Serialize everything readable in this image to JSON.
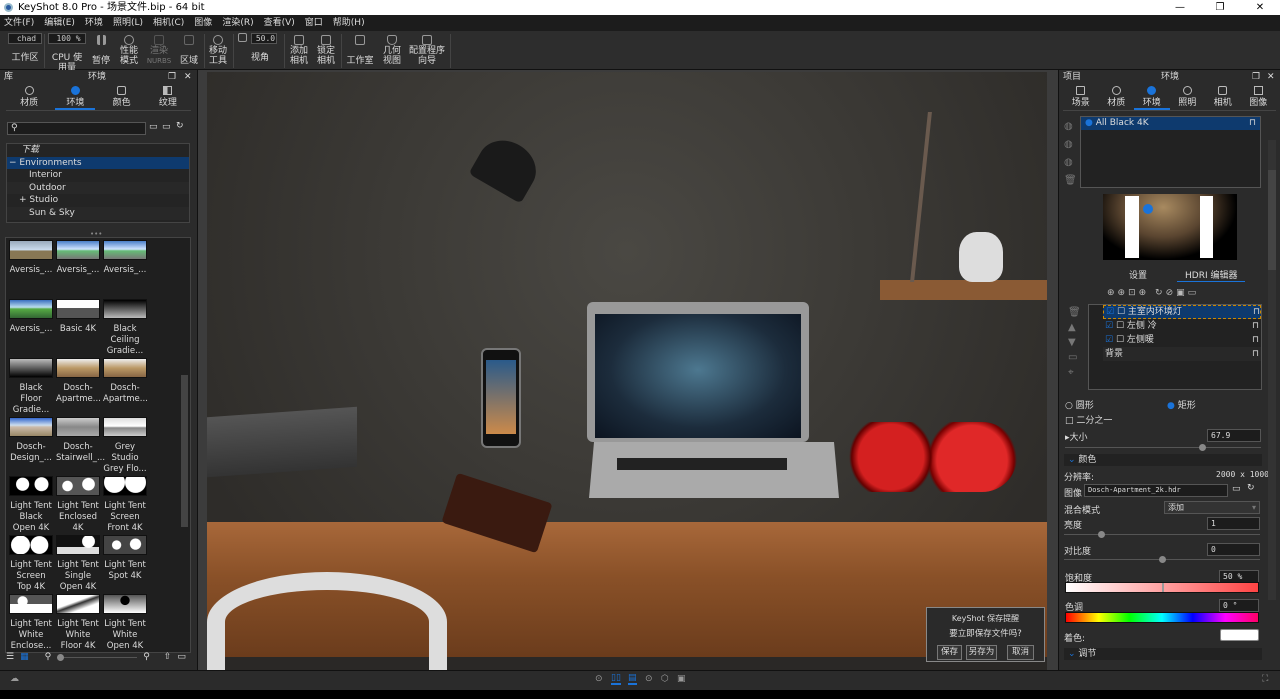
{
  "window": {
    "title": "KeyShot 8.0 Pro  - 场景文件.bip  - 64 bit",
    "min": "—",
    "max": "❐",
    "close": "✕"
  },
  "menu": [
    "文件(F)",
    "编辑(E)",
    "环境",
    "照明(L)",
    "相机(C)",
    "图像",
    "渲染(R)",
    "查看(V)",
    "窗口",
    "帮助(H)"
  ],
  "toolbar": {
    "workspace_value": "chad",
    "workspace": "工作区",
    "cpu_value": "100 %",
    "cpu": "CPU 使用量",
    "pause": "暂停",
    "perf1": "性能",
    "perf2": "模式",
    "nurbs1": "渲染",
    "nurbs2": "NURBS",
    "region": "区域",
    "move1": "移动",
    "move2": "工具",
    "fov_value": "50.0",
    "fov": "视角",
    "addcam1": "添加",
    "addcam2": "相机",
    "lockcam1": "锁定",
    "lockcam2": "相机",
    "studio": "工作室",
    "geo1": "几何",
    "geo2": "视图",
    "wizard1": "配置程序",
    "wizard2": "向导"
  },
  "library": {
    "header": "库",
    "title": "环境",
    "tabs": [
      {
        "label": "材质"
      },
      {
        "label": "环境"
      },
      {
        "label": "颜色"
      },
      {
        "label": "纹理"
      }
    ],
    "search_placeholder": "",
    "tree": [
      "下载",
      "Environments",
      "Interior",
      "Outdoor",
      "Studio",
      "Sun & Sky"
    ],
    "thumbs": [
      {
        "label": "Aversis_...",
        "bg": "linear-gradient(#9ab,#cde 50%,#875 55%)"
      },
      {
        "label": "Aversis_...",
        "bg": "linear-gradient(#4a7fc8,#cfe3ff 45%,#6b7 55%,#777)"
      },
      {
        "label": "Aversis_...",
        "bg": "linear-gradient(#4a7fc8,#cfe3ff 45%,#6b7 55%,#777)"
      },
      {
        "label": "Aversis_...",
        "bg": "linear-gradient(#3a6fc0,#bde 40%,#5a4 50%,#363)"
      },
      {
        "label": "Basic 4K",
        "bg": "linear-gradient(#fff 45%,#555 45%)"
      },
      {
        "label": "Black Ceiling Gradie...",
        "bg": "linear-gradient(#000,#bbb)"
      },
      {
        "label": "Black Floor Gradie...",
        "bg": "linear-gradient(#bbb,#000)"
      },
      {
        "label": "Dosch-Apartme...",
        "bg": "linear-gradient(#eee,#b96 50%,#864)"
      },
      {
        "label": "Dosch-Apartme...",
        "bg": "linear-gradient(#eee,#b96 50%,#864)"
      },
      {
        "label": "Dosch-Design_...",
        "bg": "linear-gradient(#36c,#cde 40%,#cba 50%,#986)"
      },
      {
        "label": "Dosch-Stairwell_...",
        "bg": "linear-gradient(#ccc,#888 50%,#aaa)"
      },
      {
        "label": "Grey Studio Grey Flo...",
        "bg": "linear-gradient(#ddd,#fff 45%,#888 55%,#ccc)"
      },
      {
        "label": "Light Tent Black Open 4K",
        "bg": "radial-gradient(circle at 30% 40%,#fff 20%,transparent 22%),radial-gradient(circle at 75% 40%,#fff 20%,#000 22%)"
      },
      {
        "label": "Light Tent Enclosed 4K",
        "bg": "radial-gradient(circle at 25% 50%,#fff 15%,transparent 17%),radial-gradient(circle at 75% 40%,#fff 18%,#555 20%)"
      },
      {
        "label": "Light Tent Screen Front 4K",
        "bg": "radial-gradient(circle at 25% 30%,#fff 30%,transparent 32%),radial-gradient(circle at 75% 30%,#fff 30%,#000 32%)"
      },
      {
        "label": "Light Tent Screen Top 4K",
        "bg": "radial-gradient(circle at 25% 50%,#fff 28%,transparent 30%),radial-gradient(circle at 70% 50%,#fff 28%,#000 30%)"
      },
      {
        "label": "Light Tent Single Open 4K",
        "bg": "radial-gradient(circle at 75% 30%,#fff 18%,transparent 20%),linear-gradient(#111 60%,#ddd 60%)"
      },
      {
        "label": "Light Tent Spot 4K",
        "bg": "radial-gradient(circle at 30% 50%,#fff 14%,transparent 16%),radial-gradient(circle at 75% 45%,#fff 16%,#444 18%)"
      },
      {
        "label": "Light Tent White Enclose...",
        "bg": "radial-gradient(circle at 30% 35%,#fff 15%,transparent 17%),linear-gradient(#555 50%,#fff 50%)"
      },
      {
        "label": "Light Tent White Floor 4K",
        "bg": "linear-gradient(160deg,#fff 40%,#333 50%,#fff 70%)"
      },
      {
        "label": "Light Tent White Open 4K",
        "bg": "radial-gradient(circle at 50% 30%,#000 18%,transparent 20%),linear-gradient(#555,#fff)"
      }
    ]
  },
  "project": {
    "header": "项目",
    "title": "环境",
    "tabs": [
      {
        "label": "场景"
      },
      {
        "label": "材质"
      },
      {
        "label": "环境"
      },
      {
        "label": "照明"
      },
      {
        "label": "相机"
      },
      {
        "label": "图像"
      }
    ],
    "env_list": [
      "All Black 4K"
    ],
    "subtabs": [
      "设置",
      "HDRI 编辑器"
    ],
    "pins": [
      {
        "name": "主室内环境灯",
        "checked": true
      },
      {
        "name": "左侧 冷",
        "checked": true
      },
      {
        "name": "左侧暖",
        "checked": true
      }
    ],
    "background": "背景",
    "shape_circle": "圆形",
    "shape_rect": "矩形",
    "half": "二分之一",
    "size_label": "大小",
    "size_value": "67.9",
    "color_section": "颜色",
    "resolution_label": "分辨率:",
    "resolution_value": "2000 x 1000",
    "image_label": "图像",
    "image_value": "Dosch-Apartment_2k.hdr",
    "blend_label": "混合模式",
    "blend_value": "添加",
    "brightness_label": "亮度",
    "brightness_value": "1",
    "brightness_level": 0.18,
    "contrast_label": "对比度",
    "contrast_value": "0",
    "contrast_level": 0.5,
    "saturation_label": "饱和度",
    "saturation_value": "50 %",
    "saturation_level": 0.5,
    "hue_label": "色调",
    "hue_value": "0 °",
    "tint_label": "着色:",
    "tint_color": "#ffffff",
    "adjust_section": "调节"
  },
  "dialog": {
    "title": "KeyShot 保存提醒",
    "message": "要立即保存文件吗?",
    "save": "保存",
    "save_as": "另存为",
    "cancel": "取消"
  },
  "colors": {
    "accent": "#1a73d9",
    "selection": "#0e3a6e"
  }
}
